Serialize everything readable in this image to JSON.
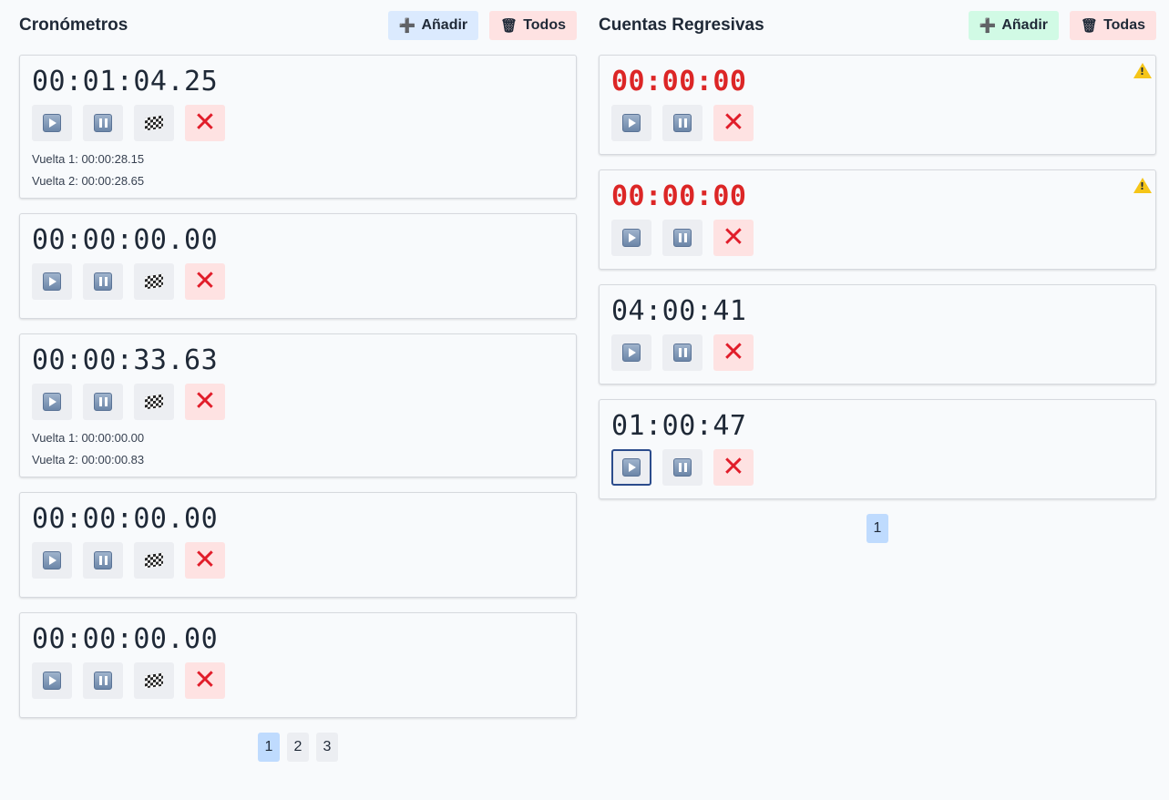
{
  "stopwatches": {
    "title": "Cronómetros",
    "add_label": "Añadir",
    "add_icon": "plus-icon",
    "delete_all_label": "Todos",
    "delete_all_icon": "wastebasket-icon",
    "items": [
      {
        "time": "00:01:04.25",
        "laps": [
          "Vuelta 1: 00:00:28.15",
          "Vuelta 2: 00:00:28.65"
        ]
      },
      {
        "time": "00:00:00.00",
        "laps": []
      },
      {
        "time": "00:00:33.63",
        "laps": [
          "Vuelta 1: 00:00:00.00",
          "Vuelta 2: 00:00:00.83"
        ]
      },
      {
        "time": "00:00:00.00",
        "laps": []
      },
      {
        "time": "00:00:00.00",
        "laps": []
      }
    ],
    "pages": [
      "1",
      "2",
      "3"
    ],
    "active_page": "1"
  },
  "countdowns": {
    "title": "Cuentas Regresivas",
    "add_label": "Añadir",
    "add_icon": "plus-icon",
    "delete_all_label": "Todas",
    "delete_all_icon": "wastebasket-icon",
    "items": [
      {
        "time": "00:00:00",
        "expired": true
      },
      {
        "time": "00:00:00",
        "expired": true
      },
      {
        "time": "04:00:41",
        "expired": false
      },
      {
        "time": "01:00:47",
        "expired": false
      }
    ],
    "pages": [
      "1"
    ],
    "active_page": "1"
  },
  "colors": {
    "add_stopwatch_bg": "#dbeafe",
    "add_countdown_bg": "#d1fae5",
    "delete_bg": "#fee2e2",
    "expired_text": "#dc2626",
    "warning": "#f5c518",
    "active_page_bg": "#bfdbfe"
  }
}
